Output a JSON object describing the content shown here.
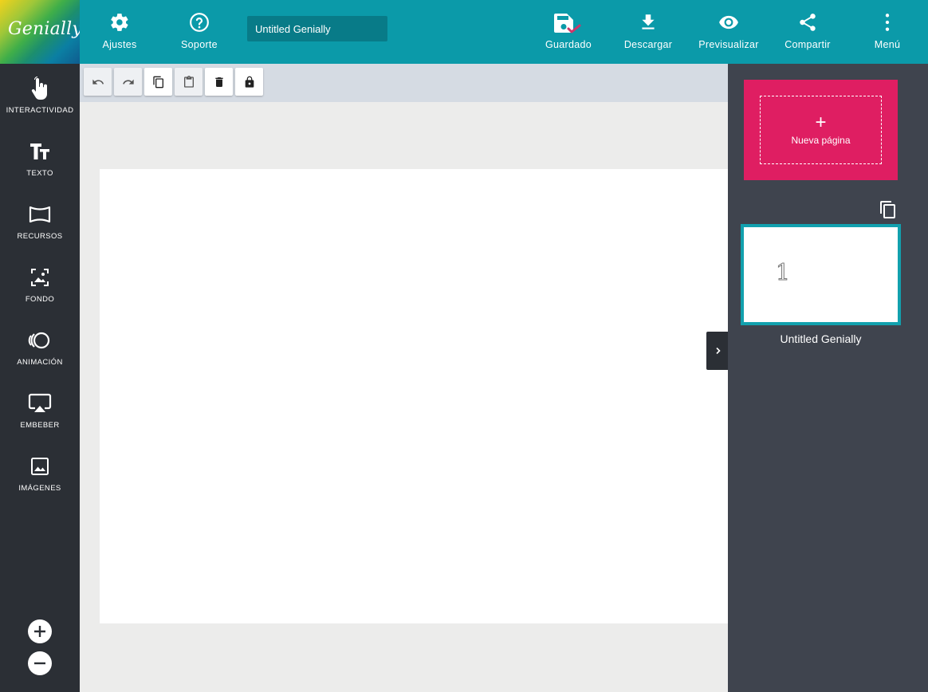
{
  "brand": {
    "logo_text": "Genially"
  },
  "header": {
    "settings_label": "Ajustes",
    "support_label": "Soporte",
    "title_value": "Untitled Genially",
    "saved_label": "Guardado",
    "download_label": "Descargar",
    "preview_label": "Previsualizar",
    "share_label": "Compartir",
    "menu_label": "Menú"
  },
  "sidebar": {
    "items": [
      {
        "label": "INTERACTIVIDAD",
        "icon": "hand-pointer-icon"
      },
      {
        "label": "TEXTO",
        "icon": "text-size-icon"
      },
      {
        "label": "RECURSOS",
        "icon": "resources-icon"
      },
      {
        "label": "FONDO",
        "icon": "background-image-icon"
      },
      {
        "label": "ANIMACIÓN",
        "icon": "animation-icon"
      },
      {
        "label": "EMBEBER",
        "icon": "embed-screen-icon"
      },
      {
        "label": "IMÁGENES",
        "icon": "image-icon"
      }
    ],
    "zoom_in_icon": "plus-icon",
    "zoom_out_icon": "minus-icon"
  },
  "toolbar": {
    "tools": [
      "undo-icon",
      "redo-icon",
      "copy-icon",
      "paste-icon",
      "delete-icon",
      "lock-icon"
    ]
  },
  "pages_panel": {
    "new_page_plus": "+",
    "new_page_label": "Nueva página",
    "pages": [
      {
        "number": "1",
        "title": "Untitled Genially"
      }
    ]
  },
  "colors": {
    "header_bg": "#0b9aa9",
    "sidebar_bg": "#2b2f35",
    "panel_bg": "#3f444e",
    "accent_pink": "#df1e62",
    "saved_check": "#d0356a",
    "thumb_border": "#12a1ae"
  }
}
